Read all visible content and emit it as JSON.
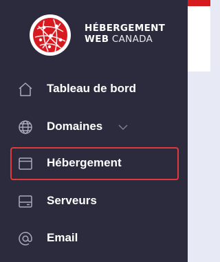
{
  "brand": {
    "line1": "HÉBERGEMENT",
    "line2_bold": "WEB",
    "line2_light": " CANADA",
    "logo_color": "#d71920"
  },
  "nav": {
    "items": [
      {
        "label": "Tableau de bord",
        "icon": "home-icon"
      },
      {
        "label": "Domaines",
        "icon": "globe-icon",
        "has_dropdown": true
      },
      {
        "label": "Hébergement",
        "icon": "window-icon",
        "active": true
      },
      {
        "label": "Serveurs",
        "icon": "server-icon"
      },
      {
        "label": "Email",
        "icon": "at-icon"
      }
    ]
  },
  "colors": {
    "sidebar_bg": "#2b2b3d",
    "highlight_border": "#e23a3a",
    "header_accent": "#d71920",
    "content_bg": "#e7e9f4"
  }
}
